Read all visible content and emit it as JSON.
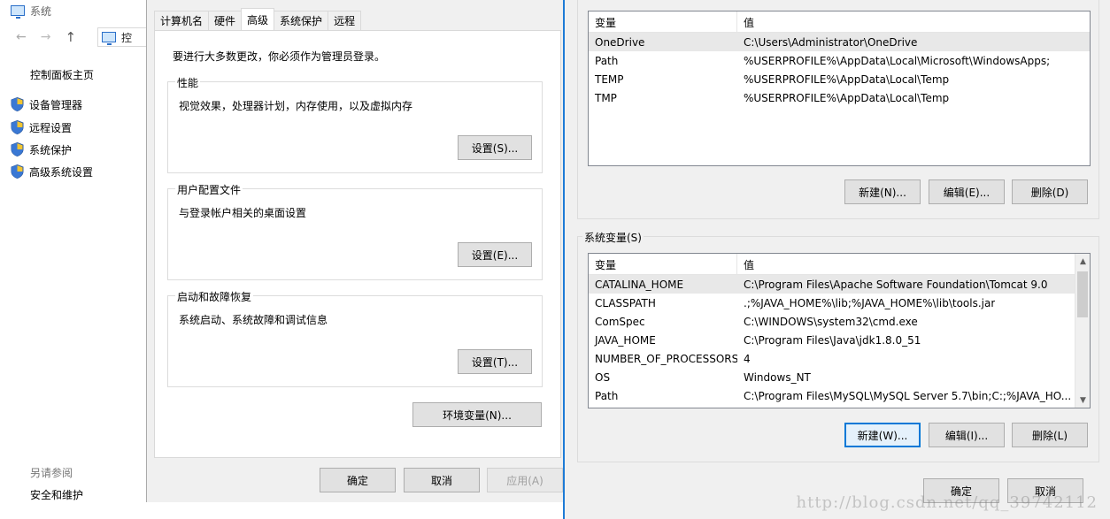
{
  "system_window": {
    "title": "系统",
    "address_text": "控",
    "control_panel_home": "控制面板主页",
    "links": [
      {
        "label": "设备管理器"
      },
      {
        "label": "远程设置"
      },
      {
        "label": "系统保护"
      },
      {
        "label": "高级系统设置"
      }
    ],
    "see_also": "另请参阅",
    "security_maintenance": "安全和维护"
  },
  "system_properties": {
    "tabs": [
      {
        "label": "计算机名"
      },
      {
        "label": "硬件"
      },
      {
        "label": "高级"
      },
      {
        "label": "系统保护"
      },
      {
        "label": "远程"
      }
    ],
    "active_tab": "高级",
    "admin_note": "要进行大多数更改，你必须作为管理员登录。",
    "performance": {
      "title": "性能",
      "desc": "视觉效果，处理器计划，内存使用，以及虚拟内存",
      "button": "设置(S)..."
    },
    "user_profiles": {
      "title": "用户配置文件",
      "desc": "与登录帐户相关的桌面设置",
      "button": "设置(E)..."
    },
    "startup_recovery": {
      "title": "启动和故障恢复",
      "desc": "系统启动、系统故障和调试信息",
      "button": "设置(T)..."
    },
    "env_button": "环境变量(N)...",
    "ok": "确定",
    "cancel": "取消",
    "apply": "应用(A)"
  },
  "environment_variables": {
    "user_vars": {
      "header_var": "变量",
      "header_val": "值",
      "rows": [
        {
          "name": "OneDrive",
          "value": "C:\\Users\\Administrator\\OneDrive"
        },
        {
          "name": "Path",
          "value": "%USERPROFILE%\\AppData\\Local\\Microsoft\\WindowsApps;"
        },
        {
          "name": "TEMP",
          "value": "%USERPROFILE%\\AppData\\Local\\Temp"
        },
        {
          "name": "TMP",
          "value": "%USERPROFILE%\\AppData\\Local\\Temp"
        }
      ],
      "new_button": "新建(N)...",
      "edit_button": "编辑(E)...",
      "delete_button": "删除(D)"
    },
    "system_vars": {
      "title": "系统变量(S)",
      "header_var": "变量",
      "header_val": "值",
      "rows": [
        {
          "name": "CATALINA_HOME",
          "value": "C:\\Program Files\\Apache Software Foundation\\Tomcat 9.0"
        },
        {
          "name": "CLASSPATH",
          "value": ".;%JAVA_HOME%\\lib;%JAVA_HOME%\\lib\\tools.jar"
        },
        {
          "name": "ComSpec",
          "value": "C:\\WINDOWS\\system32\\cmd.exe"
        },
        {
          "name": "JAVA_HOME",
          "value": "C:\\Program Files\\Java\\jdk1.8.0_51"
        },
        {
          "name": "NUMBER_OF_PROCESSORS",
          "value": "4"
        },
        {
          "name": "OS",
          "value": "Windows_NT"
        },
        {
          "name": "Path",
          "value": "C:\\Program Files\\MySQL\\MySQL Server 5.7\\bin;C:;%JAVA_HO..."
        }
      ],
      "new_button": "新建(W)...",
      "edit_button": "编辑(I)...",
      "delete_button": "删除(L)"
    },
    "ok": "确定",
    "cancel": "取消"
  },
  "watermark": "http://blog.csdn.net/qq_39742112"
}
